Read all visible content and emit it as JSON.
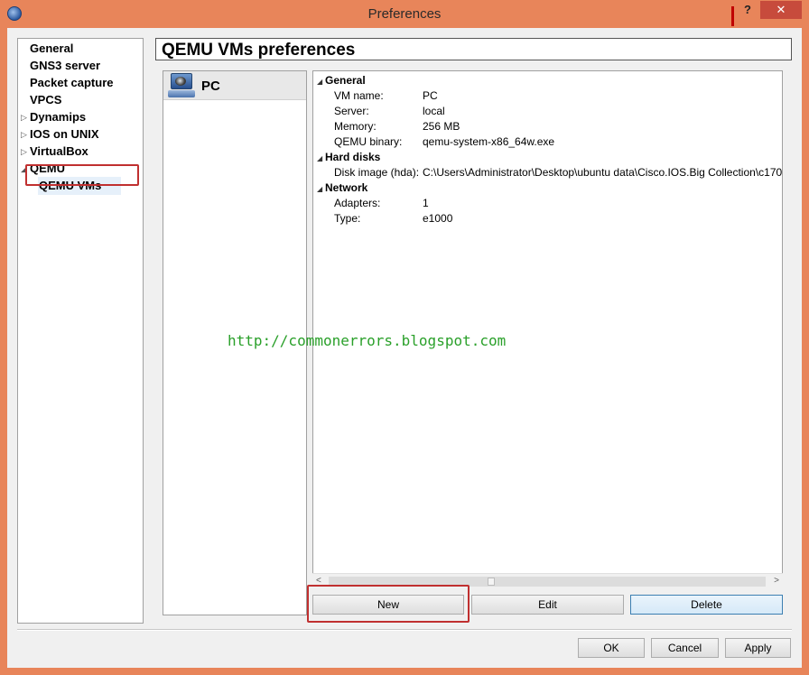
{
  "window": {
    "title": "Preferences",
    "help_label": "?",
    "close_label": "✕",
    "app_icon": "gns3-logo-icon"
  },
  "nav": {
    "items": [
      {
        "label": "General",
        "expandable": false
      },
      {
        "label": "GNS3 server",
        "expandable": false
      },
      {
        "label": "Packet capture",
        "expandable": false
      },
      {
        "label": "VPCS",
        "expandable": false
      },
      {
        "label": "Dynamips",
        "expandable": true,
        "expanded": false
      },
      {
        "label": "IOS on UNIX",
        "expandable": true,
        "expanded": false
      },
      {
        "label": "VirtualBox",
        "expandable": true,
        "expanded": false
      },
      {
        "label": "QEMU",
        "expandable": true,
        "expanded": true
      },
      {
        "label": "QEMU VMs",
        "selected": true
      }
    ],
    "collapsed_arrow": "▷",
    "expanded_arrow": "◢"
  },
  "page": {
    "title": "QEMU VMs preferences"
  },
  "vm_list": {
    "items": [
      {
        "label": "PC",
        "icon": "pc-icon"
      }
    ]
  },
  "details": {
    "sections": [
      {
        "title": "General",
        "rows": [
          {
            "key": "VM name:",
            "value": "PC"
          },
          {
            "key": "Server:",
            "value": "local"
          },
          {
            "key": "Memory:",
            "value": "256 MB"
          },
          {
            "key": "QEMU binary:",
            "value": "qemu-system-x86_64w.exe"
          }
        ]
      },
      {
        "title": "Hard disks",
        "rows": [
          {
            "key": "Disk image (hda):",
            "value": "C:\\Users\\Administrator\\Desktop\\ubuntu data\\Cisco.IOS.Big Collection\\c170"
          }
        ]
      },
      {
        "title": "Network",
        "rows": [
          {
            "key": "Adapters:",
            "value": "1"
          },
          {
            "key": "Type:",
            "value": "e1000"
          }
        ]
      }
    ],
    "section_arrow": "◢"
  },
  "buttons": {
    "new": "New",
    "edit": "Edit",
    "delete": "Delete",
    "ok": "OK",
    "cancel": "Cancel",
    "apply": "Apply"
  },
  "scrollbar": {
    "left_arrow": "<",
    "right_arrow": ">"
  },
  "watermark": "http://commonerrors.blogspot.com",
  "colors": {
    "window_frame": "#e8855a",
    "highlight_box": "#c03030",
    "watermark": "#2aa02a",
    "close_button": "#c74b3c"
  }
}
